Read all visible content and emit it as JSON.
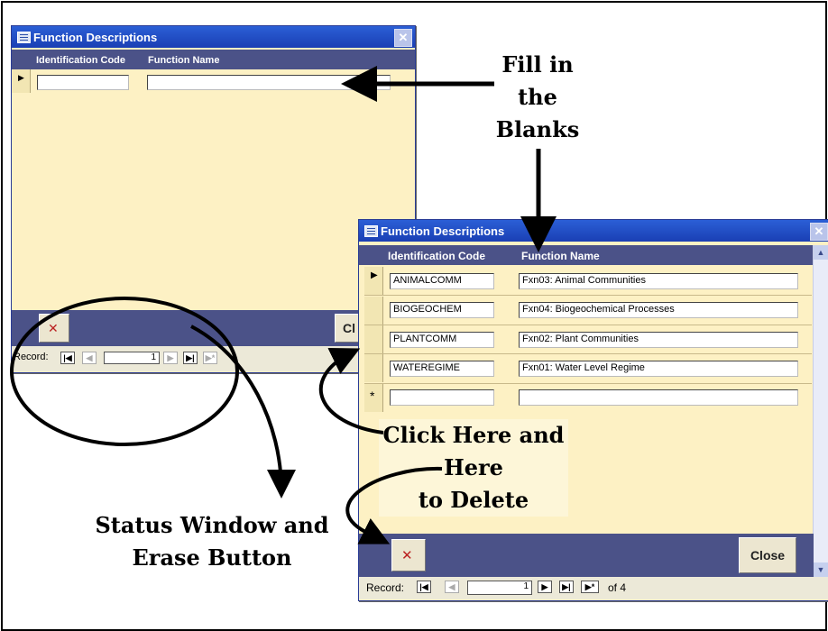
{
  "back_window": {
    "title": "Function Descriptions",
    "columns": [
      "Identification Code",
      "Function Name"
    ],
    "record_label": "Record:",
    "record_number": "1",
    "close_label": "Cl"
  },
  "front_window": {
    "title": "Function Descriptions",
    "columns": [
      "Identification Code",
      "Function Name"
    ],
    "rows": [
      {
        "code": "ANIMALCOMM",
        "name": "Fxn03:  Animal Communities"
      },
      {
        "code": "BIOGEOCHEM",
        "name": "Fxn04:  Biogeochemical Processes"
      },
      {
        "code": "PLANTCOMM",
        "name": "Fxn02:  Plant Communities"
      },
      {
        "code": "WATEREGIME",
        "name": "Fxn01:  Water Level Regime"
      }
    ],
    "new_row_marker": "*",
    "current_row_marker": "▶",
    "close_label": "Close",
    "record_label": "Record:",
    "record_number": "1",
    "record_of": "of 4"
  },
  "annotations": {
    "fill_line1": "Fill in",
    "fill_line2": "the",
    "fill_line3": "Blanks",
    "click_line1": "Click Here and",
    "click_line2": "Here",
    "click_line3": "to Delete",
    "status_line1": "Status Window and",
    "status_line2": "Erase Button"
  },
  "colors": {
    "form_background": "#fdf1c4",
    "header_band": "#4b5288",
    "title_bar": "#1f4cc4"
  }
}
